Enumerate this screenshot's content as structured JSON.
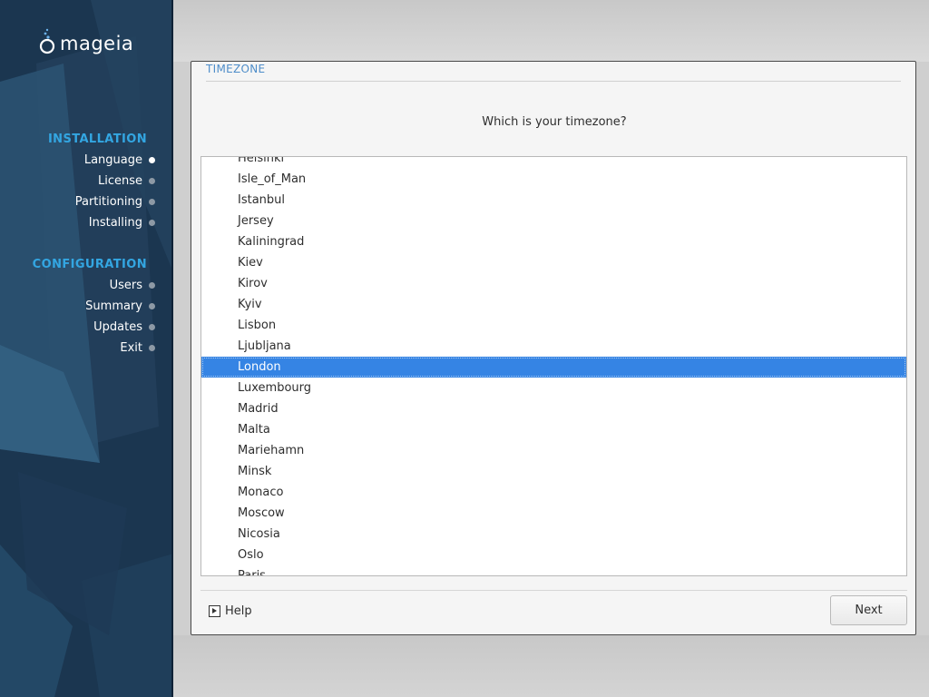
{
  "sidebar": {
    "logo_text": "mageia",
    "sections": [
      {
        "heading": "INSTALLATION",
        "items": [
          {
            "label": "Language",
            "active": true
          },
          {
            "label": "License",
            "active": false
          },
          {
            "label": "Partitioning",
            "active": false
          },
          {
            "label": "Installing",
            "active": false
          }
        ]
      },
      {
        "heading": "CONFIGURATION",
        "items": [
          {
            "label": "Users",
            "active": false
          },
          {
            "label": "Summary",
            "active": false
          },
          {
            "label": "Updates",
            "active": false
          },
          {
            "label": "Exit",
            "active": false
          }
        ]
      }
    ]
  },
  "dialog": {
    "title": "TIMEZONE",
    "question": "Which is your timezone?",
    "timezones": [
      "Helsinki",
      "Isle_of_Man",
      "Istanbul",
      "Jersey",
      "Kaliningrad",
      "Kiev",
      "Kirov",
      "Kyiv",
      "Lisbon",
      "Ljubljana",
      "London",
      "Luxembourg",
      "Madrid",
      "Malta",
      "Mariehamn",
      "Minsk",
      "Monaco",
      "Moscow",
      "Nicosia",
      "Oslo",
      "Paris"
    ],
    "selected": "London",
    "help_label": "Help",
    "next_label": "Next"
  },
  "colors": {
    "accent": "#33a6e2",
    "selection": "#3584e4",
    "title": "#4e8dc9",
    "sidebar_bg": "#1b3650"
  },
  "icons": {
    "logo": "mageia-cauldron-icon",
    "help": "play-triangle-icon",
    "nav_marker": "dot-icon"
  }
}
